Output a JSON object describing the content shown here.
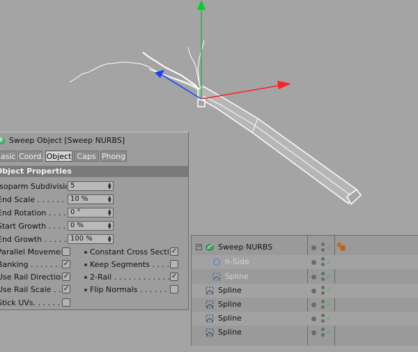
{
  "attribute_panel": {
    "title": "Sweep Object [Sweep NURBS]",
    "tabs": [
      {
        "label": "Basic",
        "active": false
      },
      {
        "label": "Coord.",
        "active": false
      },
      {
        "label": "Object",
        "active": true
      },
      {
        "label": "Caps",
        "active": false
      },
      {
        "label": "Phong",
        "active": false
      }
    ],
    "section": "Object Properties",
    "fields": [
      {
        "label": "Isoparm Subdivision",
        "value": "5"
      },
      {
        "label": "End Scale . . . . . . .",
        "value": "10 %"
      },
      {
        "label": "End Rotation . . . . .",
        "value": "0 °"
      },
      {
        "label": "Start Growth . . . . .",
        "value": "0 %"
      },
      {
        "label": "End Growth . . . . . .",
        "value": "100 %"
      }
    ],
    "left_checks": [
      {
        "label": "Parallel Movement",
        "checked": false
      },
      {
        "label": "Banking . . . . . . . . .",
        "checked": true
      },
      {
        "label": "Use Rail Direction",
        "checked": true
      },
      {
        "label": "Use Rail Scale . . .",
        "checked": true
      },
      {
        "label": "Stick UVs. . . . . . .",
        "checked": false
      }
    ],
    "right_checks": [
      {
        "label": "Constant Cross Section",
        "checked": true
      },
      {
        "label": "Keep Segments . . . . . . .",
        "checked": false
      },
      {
        "label": "2-Rail . . . . . . . . . . . . . . .",
        "checked": true
      },
      {
        "label": "Flip Normals . . . . . . . . . .",
        "checked": false
      }
    ]
  },
  "object_manager": {
    "objects": [
      {
        "name": "Sweep NURBS",
        "icon": "sweep-nurbs-icon",
        "dim": false
      },
      {
        "name": "n-Side",
        "icon": "nside-icon",
        "dim": true
      },
      {
        "name": "Spline",
        "icon": "spline-icon",
        "dim": true
      },
      {
        "name": "Spline",
        "icon": "spline-icon",
        "dim": false
      },
      {
        "name": "Spline",
        "icon": "spline-icon",
        "dim": false
      },
      {
        "name": "Spline",
        "icon": "spline-icon",
        "dim": false
      },
      {
        "name": "Spline",
        "icon": "spline-icon",
        "dim": false
      }
    ]
  },
  "axis_colors": {
    "x": "#ff2020",
    "y": "#00d020",
    "z": "#1840ff"
  }
}
